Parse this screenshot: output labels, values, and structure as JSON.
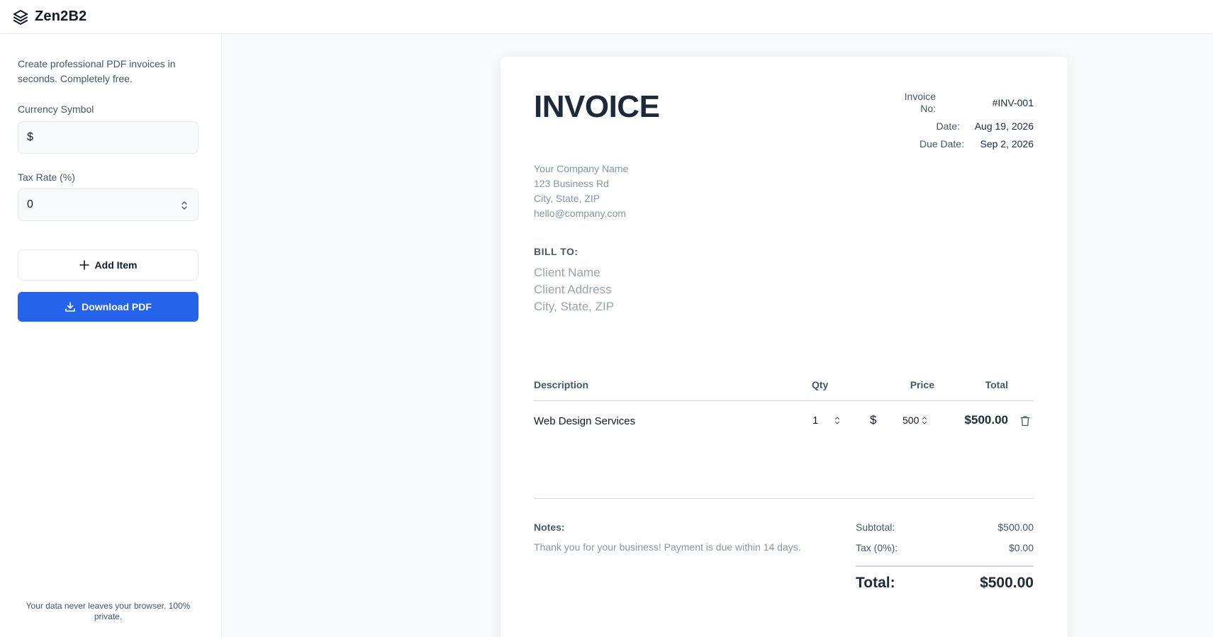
{
  "app": {
    "brand": "Zen2B2",
    "logo_icon": "layers-icon"
  },
  "sidebar": {
    "tagline": "Create professional PDF invoices in seconds. Completely free.",
    "currency": {
      "label": "Currency Symbol",
      "value": "$"
    },
    "tax": {
      "label": "Tax Rate (%)",
      "value": "0"
    },
    "add_item_label": "Add Item",
    "download_label": "Download PDF",
    "privacy_note": "Your data never leaves your browser. 100% private.",
    "accent_color": "#2563eb"
  },
  "invoice": {
    "title": "INVOICE",
    "company": {
      "name": "Your Company Name",
      "address": "123 Business Rd",
      "city": "City, State, ZIP",
      "email": "hello@company.com"
    },
    "meta": {
      "number_label_line1": "Invoice",
      "number_label_line2": "No:",
      "number": "#INV-001",
      "date_label": "Date:",
      "date": "Aug 19, 2026",
      "due_label": "Due Date:",
      "due_date": "Sep 2, 2026"
    },
    "bill_to": {
      "label": "BILL TO:",
      "name": "Client Name",
      "address": "Client Address",
      "city": "City, State, ZIP"
    },
    "table": {
      "headers": {
        "description": "Description",
        "qty": "Qty",
        "price": "Price",
        "total": "Total"
      },
      "rows": [
        {
          "description": "Web Design Services",
          "qty": "1",
          "currency": "$",
          "price": "500",
          "total": "$500.00"
        }
      ]
    },
    "notes": {
      "label": "Notes:",
      "text": "Thank you for your business! Payment is due within 14 days."
    },
    "summary": {
      "subtotal_label": "Subtotal:",
      "subtotal": "$500.00",
      "tax_label": "Tax (0%):",
      "tax": "$0.00",
      "total_label": "Total:",
      "total": "$500.00"
    }
  }
}
